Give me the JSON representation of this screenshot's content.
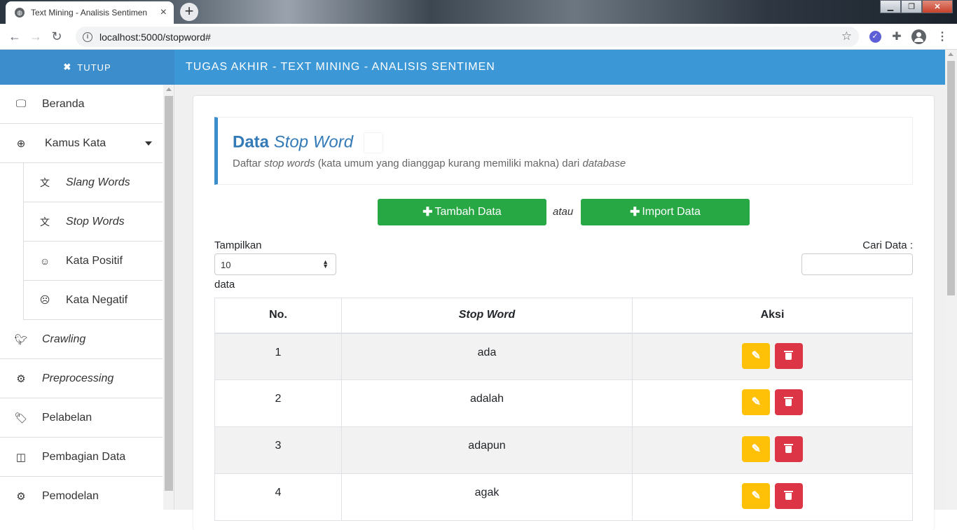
{
  "browser": {
    "tab_title": "Text Mining - Analisis Sentimen",
    "tab_close": "×",
    "new_tab": "+",
    "url": "localhost:5000/stopword#"
  },
  "sidebar": {
    "close_label": "TUTUP",
    "items": [
      {
        "label": "Beranda",
        "icon": "desktop-icon"
      },
      {
        "label": "Kamus Kata",
        "icon": "plus-circle-icon"
      },
      {
        "label": "Slang Words",
        "icon": "language-icon"
      },
      {
        "label": "Stop Words",
        "icon": "language-icon"
      },
      {
        "label": "Kata Positif",
        "icon": "smile-icon"
      },
      {
        "label": "Kata Negatif",
        "icon": "frown-icon"
      },
      {
        "label": "Crawling",
        "icon": "twitter-icon"
      },
      {
        "label": "Preprocessing",
        "icon": "gear-icon"
      },
      {
        "label": "Pelabelan",
        "icon": "tags-icon"
      },
      {
        "label": "Pembagian Data",
        "icon": "columns-icon"
      },
      {
        "label": "Pemodelan",
        "icon": "gears-icon"
      }
    ]
  },
  "header": {
    "title": "TUGAS AKHIR - TEXT MINING - ANALISIS SENTIMEN"
  },
  "page": {
    "title_main": "Data",
    "title_em": "Stop Word",
    "subtitle_1": "Daftar",
    "subtitle_em1": "stop words",
    "subtitle_2": "(kata umum yang dianggap kurang memiliki makna) dari",
    "subtitle_em2": "database",
    "add_button": "Tambah Data",
    "or_label": "atau",
    "import_button": "Import Data",
    "show_label": "Tampilkan",
    "show_value": "10",
    "data_label": "data",
    "search_label": "Cari Data :"
  },
  "table": {
    "headers": [
      "No.",
      "Stop Word",
      "Aksi"
    ],
    "rows": [
      {
        "no": "1",
        "word": "ada"
      },
      {
        "no": "2",
        "word": "adalah"
      },
      {
        "no": "3",
        "word": "adapun"
      },
      {
        "no": "4",
        "word": "agak"
      }
    ]
  },
  "colors": {
    "header_blue": "#3c97d7",
    "sidebar_head": "#3c8dcc",
    "success": "#28a745",
    "warning": "#ffc107",
    "danger": "#dc3545"
  }
}
